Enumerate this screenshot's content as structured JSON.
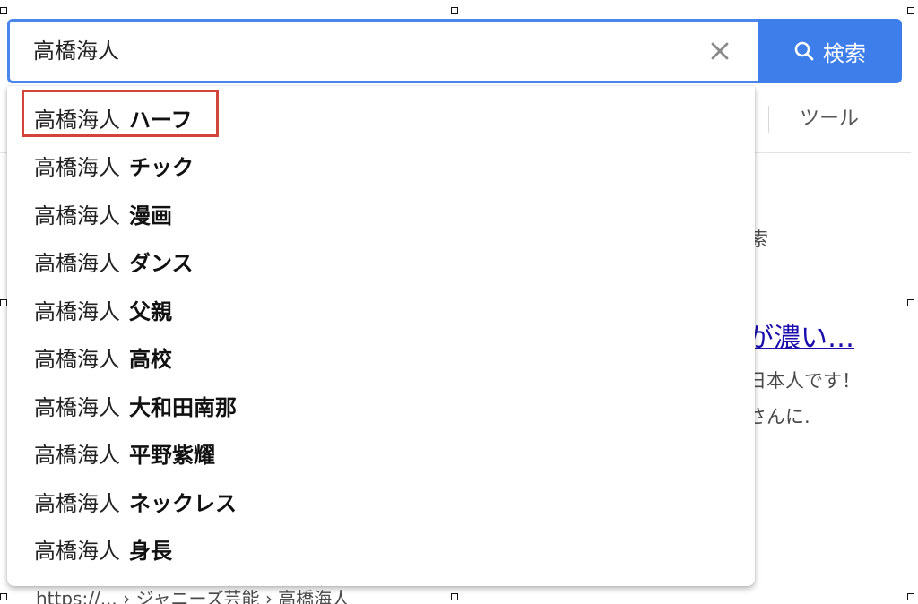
{
  "search": {
    "query": "高橋海人",
    "clear_icon": "close-icon",
    "button_icon": "search-icon",
    "button_label": "検索",
    "accent_color": "#3e7eeb"
  },
  "suggestions": [
    {
      "query": "高橋海人",
      "suffix": "ハーフ",
      "highlighted": true
    },
    {
      "query": "高橋海人",
      "suffix": "チック"
    },
    {
      "query": "高橋海人",
      "suffix": "漫画"
    },
    {
      "query": "高橋海人",
      "suffix": "ダンス"
    },
    {
      "query": "高橋海人",
      "suffix": "父親"
    },
    {
      "query": "高橋海人",
      "suffix": "高校"
    },
    {
      "query": "高橋海人",
      "suffix": "大和田南那"
    },
    {
      "query": "高橋海人",
      "suffix": "平野紫耀"
    },
    {
      "query": "高橋海人",
      "suffix": "ネックレス"
    },
    {
      "query": "高橋海人",
      "suffix": "身長"
    }
  ],
  "highlight_color": "#d2453b",
  "background": {
    "tools_label": "ツール",
    "frag_search": "索",
    "result_title_tail": "が濃い…",
    "snippet_line1": "日本人です！",
    "snippet_line2": "さんに.",
    "url_line": "https://... › ジャニーズ芸能 › 高橋海人"
  }
}
